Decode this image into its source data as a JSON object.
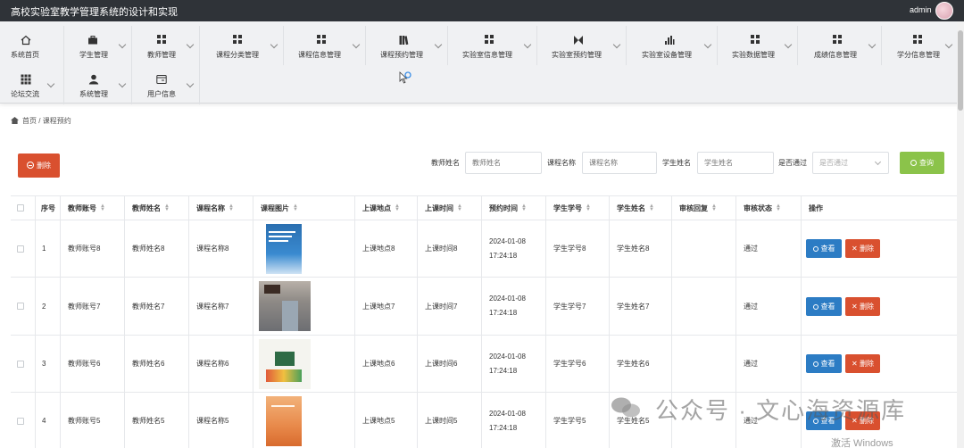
{
  "app": {
    "title": "高校实验室教学管理系统的设计和实现",
    "user": "admin"
  },
  "nav": {
    "row1": [
      {
        "label": "系统首页",
        "icon": "home-icon"
      },
      {
        "label": "学生管理",
        "icon": "briefcase-icon"
      },
      {
        "label": "教师管理",
        "icon": "grid-icon"
      },
      {
        "label": "课程分类管理",
        "icon": "grid-icon"
      },
      {
        "label": "课程信息管理",
        "icon": "grid-icon"
      },
      {
        "label": "课程预约管理",
        "icon": "book-icon"
      },
      {
        "label": "实验室信息管理",
        "icon": "grid-icon"
      },
      {
        "label": "实验室预约管理",
        "icon": "tool-icon"
      },
      {
        "label": "实验室设备管理",
        "icon": "bar-chart-icon"
      },
      {
        "label": "实验数据管理",
        "icon": "grid-icon"
      },
      {
        "label": "成绩信息管理",
        "icon": "grid-icon"
      },
      {
        "label": "学分信息管理",
        "icon": "grid-icon"
      }
    ],
    "row2": [
      {
        "label": "论坛交流",
        "icon": "apps-icon"
      },
      {
        "label": "系统管理",
        "icon": "user-icon"
      },
      {
        "label": "用户信息",
        "icon": "card-icon"
      }
    ]
  },
  "breadcrumb": {
    "home": "首页",
    "sep": "/",
    "current": "课程预约"
  },
  "toolbar": {
    "delete_label": "删除",
    "query_label": "查询",
    "filters": [
      {
        "label": "教师姓名",
        "placeholder": "教师姓名"
      },
      {
        "label": "课程名称",
        "placeholder": "课程名称"
      },
      {
        "label": "学生姓名",
        "placeholder": "学生姓名"
      },
      {
        "label": "是否通过",
        "placeholder": "是否通过"
      }
    ]
  },
  "table": {
    "columns": [
      "序号",
      "教师账号",
      "教师姓名",
      "课程名称",
      "课程图片",
      "上课地点",
      "上课时间",
      "预约时间",
      "学生学号",
      "学生姓名",
      "审核回复",
      "审核状态",
      "操作"
    ],
    "rows": [
      {
        "idx": "1",
        "teacher_no": "教师账号8",
        "teacher_name": "教师姓名8",
        "course": "课程名称8",
        "place": "上课地点8",
        "class_time": "上课时间8",
        "book_time": "2024-01-08 17:24:18",
        "student_no": "学生学号8",
        "student_name": "学生姓名8",
        "reply": "",
        "status": "通过",
        "view": "查看",
        "del": "删除"
      },
      {
        "idx": "2",
        "teacher_no": "教师账号7",
        "teacher_name": "教师姓名7",
        "course": "课程名称7",
        "place": "上课地点7",
        "class_time": "上课时间7",
        "book_time": "2024-01-08 17:24:18",
        "student_no": "学生学号7",
        "student_name": "学生姓名7",
        "reply": "",
        "status": "通过",
        "view": "查看",
        "del": "删除"
      },
      {
        "idx": "3",
        "teacher_no": "教师账号6",
        "teacher_name": "教师姓名6",
        "course": "课程名称6",
        "place": "上课地点6",
        "class_time": "上课时间6",
        "book_time": "2024-01-08 17:24:18",
        "student_no": "学生学号6",
        "student_name": "学生姓名6",
        "reply": "",
        "status": "通过",
        "view": "查看",
        "del": "删除"
      },
      {
        "idx": "4",
        "teacher_no": "教师账号5",
        "teacher_name": "教师姓名5",
        "course": "课程名称5",
        "place": "上课地点5",
        "class_time": "上课时间5",
        "book_time": "2024-01-08 17:24:18",
        "student_no": "学生学号5",
        "student_name": "学生姓名5",
        "reply": "",
        "status": "通过",
        "view": "查看",
        "del": "删除"
      }
    ]
  },
  "watermark": {
    "text": "公众号 · 文心海资源库",
    "os_notice": "激活 Windows"
  },
  "colors": {
    "topbar": "#2f3338",
    "danger": "#d9502f",
    "primary": "#2c7cc4",
    "success": "#8bc34a"
  }
}
